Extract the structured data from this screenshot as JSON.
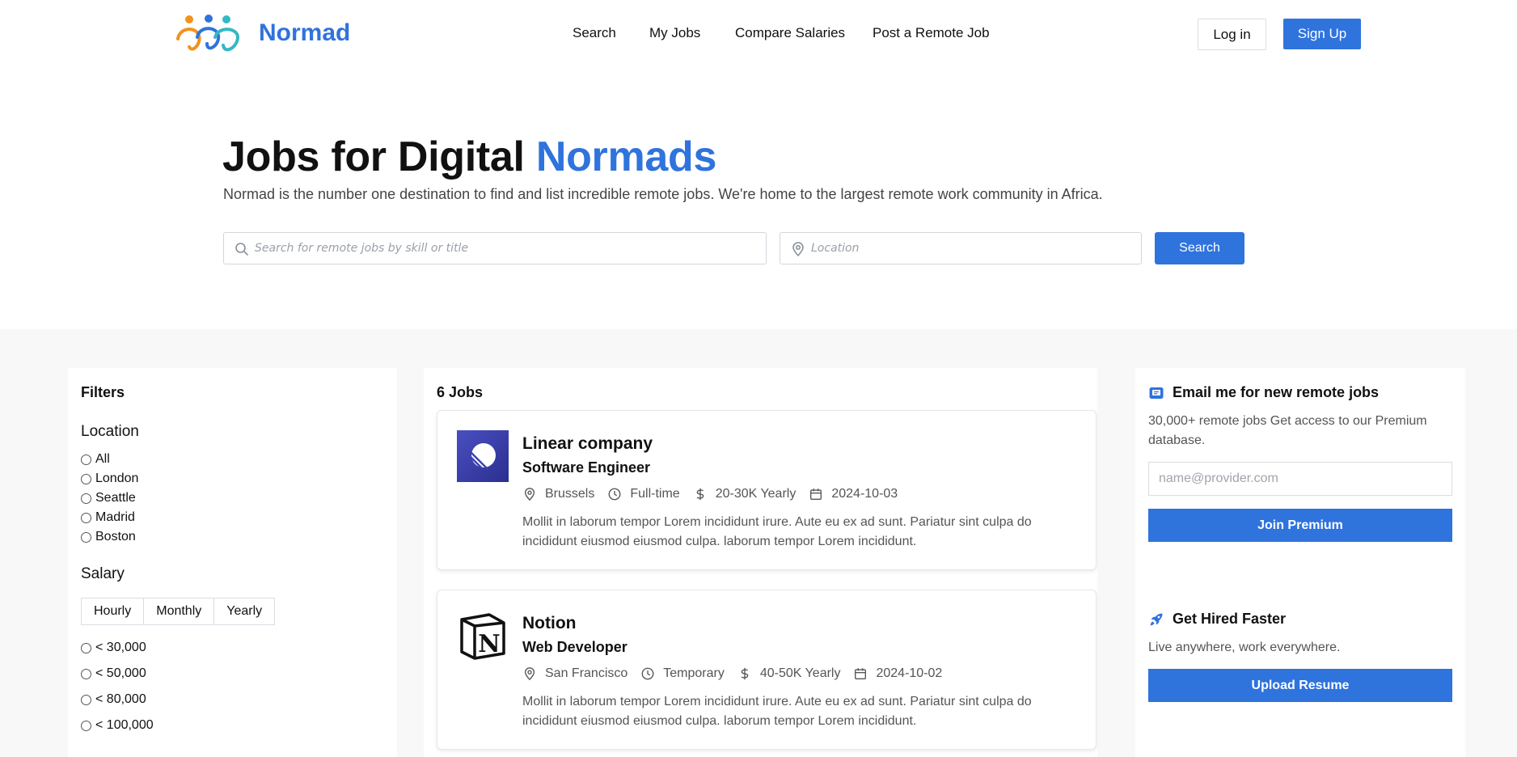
{
  "header": {
    "brand": "Normad",
    "nav": [
      {
        "label": "Search"
      },
      {
        "label": "My Jobs"
      },
      {
        "label": "Compare Salaries"
      },
      {
        "label": "Post a Remote Job"
      }
    ],
    "login_label": "Log in",
    "signup_label": "Sign Up"
  },
  "hero": {
    "title_prefix": "Jobs for Digital ",
    "title_accent": "Normads",
    "subtitle": "Normad is the number one destination to find and list incredible remote jobs. We're home to the largest remote work community in Africa.",
    "search_placeholder": "Search for remote jobs by skill or title",
    "location_placeholder": "Location",
    "search_button": "Search"
  },
  "filters": {
    "title": "Filters",
    "location_label": "Location",
    "locations": [
      "All",
      "London",
      "Seattle",
      "Madrid",
      "Boston"
    ],
    "salary_label": "Salary",
    "salary_periods": [
      "Hourly",
      "Monthly",
      "Yearly"
    ],
    "salary_ranges": [
      "< 30,000",
      "< 50,000",
      "< 80,000",
      "< 100,000"
    ]
  },
  "jobs": {
    "count_label": "6 Jobs",
    "items": [
      {
        "company": "Linear company",
        "role": "Software Engineer",
        "location": "Brussels",
        "type": "Full-time",
        "salary": "20-30K Yearly",
        "date": "2024-10-03",
        "description": "Mollit in laborum tempor Lorem incididunt irure. Aute eu ex ad sunt. Pariatur sint culpa do incididunt eiusmod eiusmod culpa. laborum tempor Lorem incididunt.",
        "logo": "linear-logo"
      },
      {
        "company": "Notion",
        "role": "Web Developer",
        "location": "San Francisco",
        "type": "Temporary",
        "salary": "40-50K Yearly",
        "date": "2024-10-02",
        "description": "Mollit in laborum tempor Lorem incididunt irure. Aute eu ex ad sunt. Pariatur sint culpa do incididunt eiusmod eiusmod culpa. laborum tempor Lorem incididunt.",
        "logo": "notion-logo"
      }
    ]
  },
  "sidebar": {
    "newsletter_title": "Email me for new remote jobs",
    "newsletter_text": "30,000+ remote jobs Get access to our Premium database.",
    "email_placeholder": "name@provider.com",
    "join_button": "Join Premium",
    "hired_title": "Get Hired Faster",
    "hired_text": "Live anywhere, work everywhere.",
    "upload_button": "Upload Resume"
  },
  "colors": {
    "accent": "#2f73dd",
    "background_section": "#f8f8f9"
  }
}
